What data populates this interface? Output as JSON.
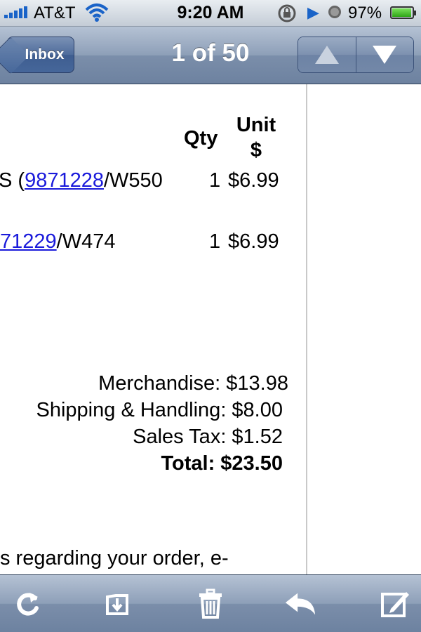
{
  "status_bar": {
    "carrier": "AT&T",
    "time": "9:20 AM",
    "battery_percent": "97%"
  },
  "nav_bar": {
    "back_label": "Inbox",
    "title": "1 of 50"
  },
  "order": {
    "col_qty": "Qty",
    "col_unit_line1": "Unit",
    "col_unit_line2": "$",
    "items": [
      {
        "prefix": "S (",
        "link": "9871228",
        "suffix": "/W550",
        "qty": "1",
        "price": "$6.99"
      },
      {
        "prefix": "",
        "link": "71229",
        "suffix": "/W474",
        "qty": "1",
        "price": "$6.99"
      }
    ],
    "merchandise": "Merchandise: $13.98",
    "shipping": "Shipping & Handling: $8.00",
    "tax": "Sales Tax: $1.52",
    "total": "Total: $23.50",
    "footer_text": "s regarding your order, e-"
  },
  "toolbar": {
    "icons": [
      "refresh-icon",
      "move-to-folder-icon",
      "trash-icon",
      "reply-icon",
      "compose-icon"
    ]
  },
  "colors": {
    "link": "#1a1adb",
    "bar_blue": "#6d82a0"
  }
}
